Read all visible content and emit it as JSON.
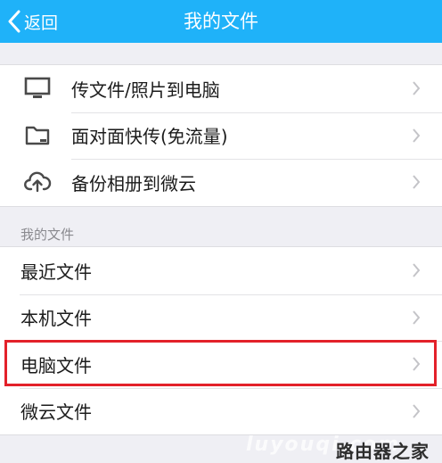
{
  "nav": {
    "back_label": "返回",
    "title": "我的文件"
  },
  "transfer_items": [
    {
      "label": "传文件/照片到电脑",
      "icon": "monitor-icon"
    },
    {
      "label": "面对面快传(免流量)",
      "icon": "folder-icon"
    },
    {
      "label": "备份相册到微云",
      "icon": "cloud-upload-icon"
    }
  ],
  "files_section": {
    "label": "我的文件",
    "items": [
      {
        "label": "最近文件"
      },
      {
        "label": "本机文件"
      },
      {
        "label": "电脑文件",
        "highlighted": true
      },
      {
        "label": "微云文件"
      }
    ]
  },
  "watermark": {
    "text": "路由器之家",
    "url": "luyouqi.com"
  },
  "colors": {
    "nav_bg": "#1fb2f9",
    "highlight_border": "#e3212a",
    "page_bg": "#efeff4"
  }
}
